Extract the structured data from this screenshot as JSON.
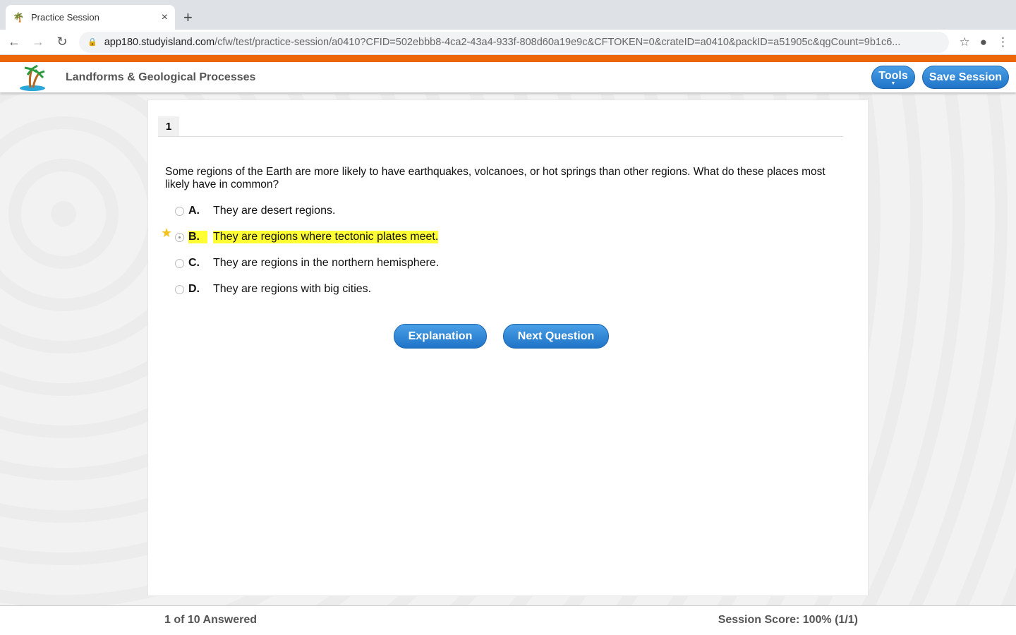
{
  "browser": {
    "tab_title": "Practice Session",
    "url_host": "app180.studyisland.com",
    "url_path": "/cfw/test/practice-session/a0410?CFID=502ebbb8-4ca2-43a4-933f-808d60a19e9c&CFTOKEN=0&crateID=a0410&packID=a51905c&qgCount=9b1c6..."
  },
  "header": {
    "title": "Landforms & Geological Processes",
    "tools_label": "Tools",
    "save_label": "Save Session"
  },
  "question": {
    "number": "1",
    "text": "Some regions of the Earth are more likely to have earthquakes, volcanoes, or hot springs than other regions. What do these places most likely have in common?",
    "answers": [
      {
        "letter": "A.",
        "text": "They are desert regions."
      },
      {
        "letter": "B.",
        "text": "They are regions where tectonic plates meet."
      },
      {
        "letter": "C.",
        "text": "They are regions in the northern hemisphere."
      },
      {
        "letter": "D.",
        "text": "They are regions with big cities."
      }
    ],
    "selected": "B"
  },
  "actions": {
    "explanation": "Explanation",
    "next": "Next Question"
  },
  "footer": {
    "answered": "1 of 10 Answered",
    "score": "Session Score: 100% (1/1)"
  },
  "colors": {
    "accent": "#ec6608",
    "button": "#2a82d6",
    "highlight": "#ffff33"
  }
}
